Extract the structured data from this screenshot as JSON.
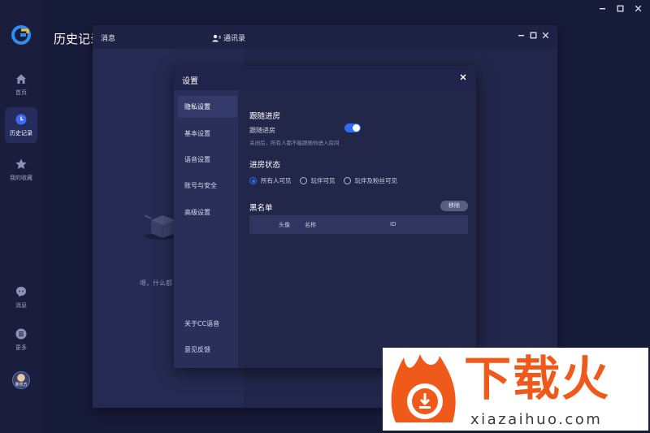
{
  "app": {
    "page_title": "历史记录",
    "colors": {
      "accent": "#2e6df0",
      "brand_orange": "#ef5a1a"
    }
  },
  "sidebar": {
    "items": [
      {
        "label": "首页",
        "icon": "home-icon"
      },
      {
        "label": "历史记录",
        "icon": "clock-icon"
      },
      {
        "label": "我的收藏",
        "icon": "star-icon"
      },
      {
        "label": "消息",
        "icon": "chat-icon"
      },
      {
        "label": "更多",
        "icon": "menu-icon"
      }
    ],
    "avatar_text": "果然方"
  },
  "message_window": {
    "tab_messages": "消息",
    "tab_contacts": "通讯录",
    "empty_text": "嗯，什么都"
  },
  "settings": {
    "title": "设置",
    "nav": [
      "隐私设置",
      "基本设置",
      "语音设置",
      "账号与安全",
      "高级设置",
      "关于CC语音",
      "意见反馈"
    ],
    "follow_section_title": "跟随进房",
    "follow_label": "跟随进房",
    "follow_hint": "关闭后，所有人都不能跟随你进入房间",
    "follow_enabled": true,
    "status_section_title": "进房状态",
    "status_options": [
      "所有人可见",
      "玩伴可见",
      "玩伴及粉丝可见"
    ],
    "status_selected": "所有人可见",
    "blacklist_title": "黑名单",
    "remove_label": "移除",
    "table_headers": [
      "头像",
      "名称",
      "ID"
    ]
  },
  "watermark": {
    "title": "下载火",
    "subtitle": "xiazaihuo.com"
  }
}
